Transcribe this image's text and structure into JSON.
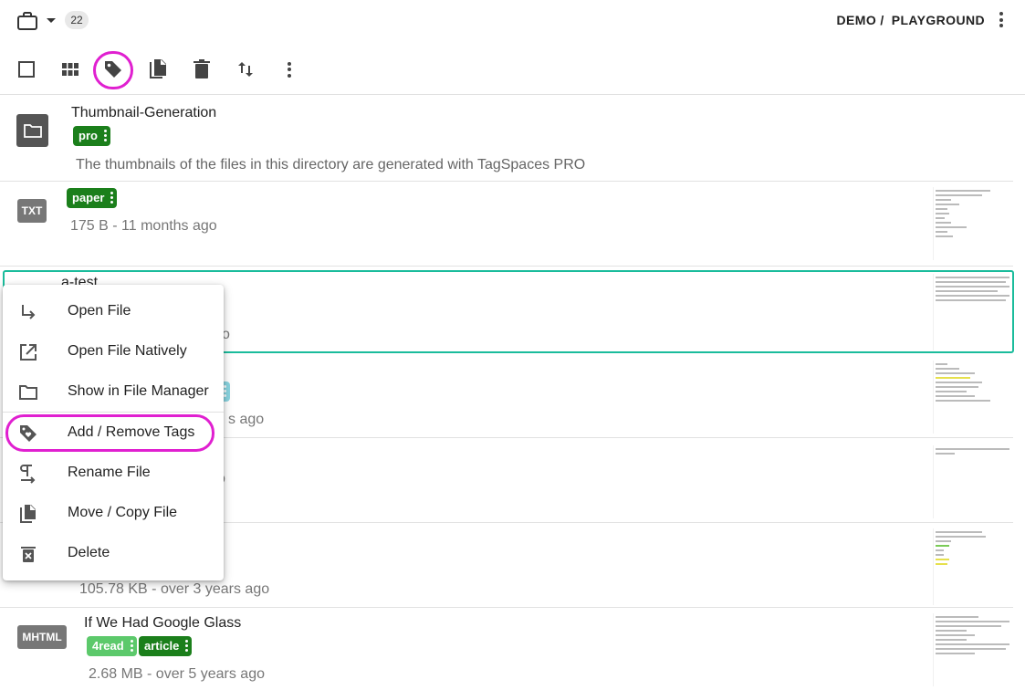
{
  "header": {
    "file_count": "22",
    "breadcrumb": [
      "DEMO /",
      "PLAYGROUND"
    ]
  },
  "toolbar": {
    "buttons": [
      {
        "icon": "checkbox-outline-icon"
      },
      {
        "icon": "grid-view-icon"
      },
      {
        "icon": "tag-icon",
        "highlighted": true
      },
      {
        "icon": "copy-icon"
      },
      {
        "icon": "delete-icon"
      },
      {
        "icon": "sort-icon"
      },
      {
        "icon": "more-vertical-icon"
      }
    ]
  },
  "files": [
    {
      "name": "Thumbnail-Generation",
      "type": "folder",
      "tags": [
        {
          "label": "pro",
          "color": "#1b7f1b"
        }
      ],
      "description": "The thumbnails of the files in this directory are generated with TagSpaces PRO"
    },
    {
      "extension": "TXT",
      "tags": [
        {
          "label": "paper",
          "color": "#1b7f1b"
        }
      ],
      "meta": "175 B -  11 months ago"
    },
    {
      "name": "a-test",
      "selected": true,
      "meta_tail": "o"
    },
    {
      "meta_tail": "s ago"
    },
    {
      "meta_tail": "o"
    },
    {
      "meta": "105.78 KB -  over 3 years ago"
    },
    {
      "name": "If We Had Google Glass",
      "extension": "MHTML",
      "tags": [
        {
          "label": "4read",
          "color": "#5cc96b"
        },
        {
          "label": "article",
          "color": "#1b7f1b"
        }
      ],
      "meta": "2.68 MB -  over 5 years ago"
    }
  ],
  "context_menu": {
    "items": [
      {
        "label": "Open File",
        "icon": "subdirectory-arrow-right-icon"
      },
      {
        "label": "Open File Natively",
        "icon": "open-in-new-icon"
      },
      {
        "label": "Show in File Manager",
        "icon": "folder-outline-icon"
      },
      {
        "label": "Add / Remove Tags",
        "icon": "tag-heart-icon",
        "highlighted": true
      },
      {
        "label": "Rename File",
        "icon": "rename-icon"
      },
      {
        "label": "Move / Copy File",
        "icon": "copy-file-icon"
      },
      {
        "label": "Delete",
        "icon": "delete-icon"
      }
    ]
  },
  "colors": {
    "highlight": "#e020d0",
    "selection": "#1abc9c",
    "tag_dark_green": "#1b7f1b",
    "tag_light_green": "#5cc96b",
    "tag_teal": "#8ad4e0"
  }
}
